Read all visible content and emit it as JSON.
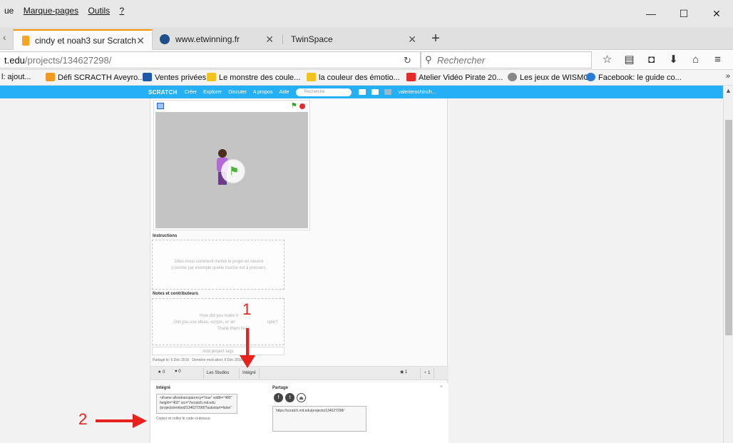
{
  "menubar": {
    "items": [
      "ue",
      "Marque-pages",
      "Outils",
      "?"
    ],
    "window_buttons": [
      "—",
      "☐",
      "✕"
    ]
  },
  "tabs": [
    {
      "label": "cindy et noah3 sur Scratch",
      "close": "✕",
      "active": true
    },
    {
      "label": "www.etwinning.fr",
      "close": "✕",
      "active": false
    },
    {
      "label": "TwinSpace",
      "close": "✕",
      "active": false
    }
  ],
  "navbar": {
    "url_host": "t.edu",
    "url_path": "/projects/134627298/",
    "search_placeholder": "Rechercher"
  },
  "bookmarks": [
    {
      "label": "l: ajout...",
      "color": "#ffffff"
    },
    {
      "label": "Défi SCRACTH Aveyro...",
      "color": "#f29a1f"
    },
    {
      "label": "Ventes privées",
      "color": "#1e5aa8"
    },
    {
      "label": "Le monstre des coule...",
      "color": "#f2c21f"
    },
    {
      "label": "la couleur des émotio...",
      "color": "#f2c21f"
    },
    {
      "label": "Atelier Vidéo Pirate 20...",
      "color": "#e52a2a"
    },
    {
      "label": "Les jeux de WISMO",
      "color": "#888888"
    },
    {
      "label": "Facebook: le guide co...",
      "color": "#2b7bd6"
    }
  ],
  "scratch_nav": {
    "logo": "SCRATCH",
    "links": [
      "Créer",
      "Explorer",
      "Discuter",
      "A propos",
      "Aide"
    ],
    "search_placeholder": "Recherche",
    "user": "valerierochinch..."
  },
  "project": {
    "instructions_title": "Instructions",
    "instructions_placeholder": [
      "Dites-nous comment mettre le projet en oeuvre",
      "(comme par exemple quelle touche est à presser)."
    ],
    "notes_title": "Notes et contributeurs",
    "notes_placeholder": [
      "How did you make it",
      "Did you use ideas, scripts, or art",
      "ople?",
      "Thank them here"
    ],
    "tags_placeholder": "Add project tags",
    "shared_date": "Partagé le: 6 Déc 2016",
    "modified_date": "Dernière mod      ation: 6 Déc 2016",
    "stars": "0",
    "loves": "0",
    "studios_button": "Les Studios",
    "embed_button": "Intégré",
    "views": "1",
    "remixes": "1"
  },
  "embed_panel": {
    "embed_title": "Intégré",
    "embed_code": "<iframe allowtransparency=\"true\" width=\"485\" height=\"402\" src=\"//scratch.mit.edu /projects/embed/134627298/?autostart=false\"",
    "copy_hint": "Copiez et collez le code ci-dessus.",
    "share_title": "Partage",
    "share_url": "https://scratch.mit.edu/projects/134627298/",
    "close": "×"
  },
  "annotations": {
    "label_1": "1",
    "label_2": "2",
    "color": "#e8211c"
  }
}
